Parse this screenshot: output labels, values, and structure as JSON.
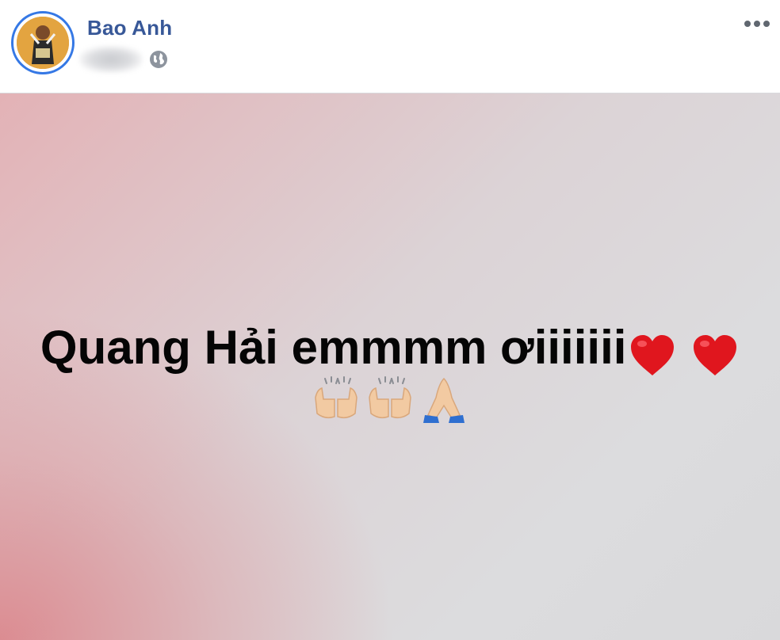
{
  "post": {
    "author": "Bao Anh",
    "privacy": "globe-icon",
    "more": "more-options-icon",
    "status_text": "Quang Hải emmmm ơiiiiiii",
    "emoji_line1": [
      "red-heart",
      "red-heart"
    ],
    "emoji_line2": [
      "raising-hands",
      "raising-hands",
      "folded-hands"
    ]
  },
  "colors": {
    "author_name": "#385898",
    "avatar_ring": "#3578e5",
    "background_gradient_from": "#db8086",
    "background_gradient_to": "#dcdcde",
    "status_text": "#050505"
  }
}
